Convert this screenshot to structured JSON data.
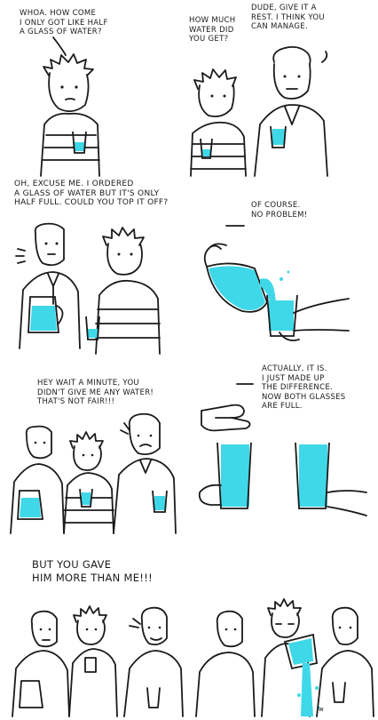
{
  "panels": [
    {
      "id": "p1",
      "caption": "WHOA. HOW COME\nI ONLY GOT LIKE HALF\nA GLASS OF WATER?"
    },
    {
      "id": "p2",
      "caption_left": "HOW MUCH\nWATER DID\nYOU GET?",
      "caption_right": "DUDE, GIVE IT A\nREST. I THINK YOU\nCAN MANAGE."
    },
    {
      "id": "p3",
      "caption": "OH, EXCUSE ME. I ORDERED\nA GLASS OF WATER BUT IT'S ONLY\nHALF FULL. COULD YOU TOP IT OFF?"
    },
    {
      "id": "p4",
      "caption": "OF COURSE.\nNO PROBLEM!"
    },
    {
      "id": "p5",
      "caption": "HEY WAIT A MINUTE, YOU\nDIDN'T GIVE ME ANY WATER!\nTHAT'S NOT FAIR!!!"
    },
    {
      "id": "p6",
      "caption": "ACTUALLY, IT IS.\nI JUST MADE UP\nTHE DIFFERENCE.\nNOW BOTH GLASSES\nARE FULL."
    },
    {
      "id": "p7",
      "caption": "BUT YOU GAVE\nHIM MORE THAN ME!!!"
    },
    {
      "id": "p8",
      "signature": "w"
    }
  ],
  "colors": {
    "ink": "#1a1a1a",
    "water": "#3fd8e8",
    "background": "#ffffff"
  }
}
